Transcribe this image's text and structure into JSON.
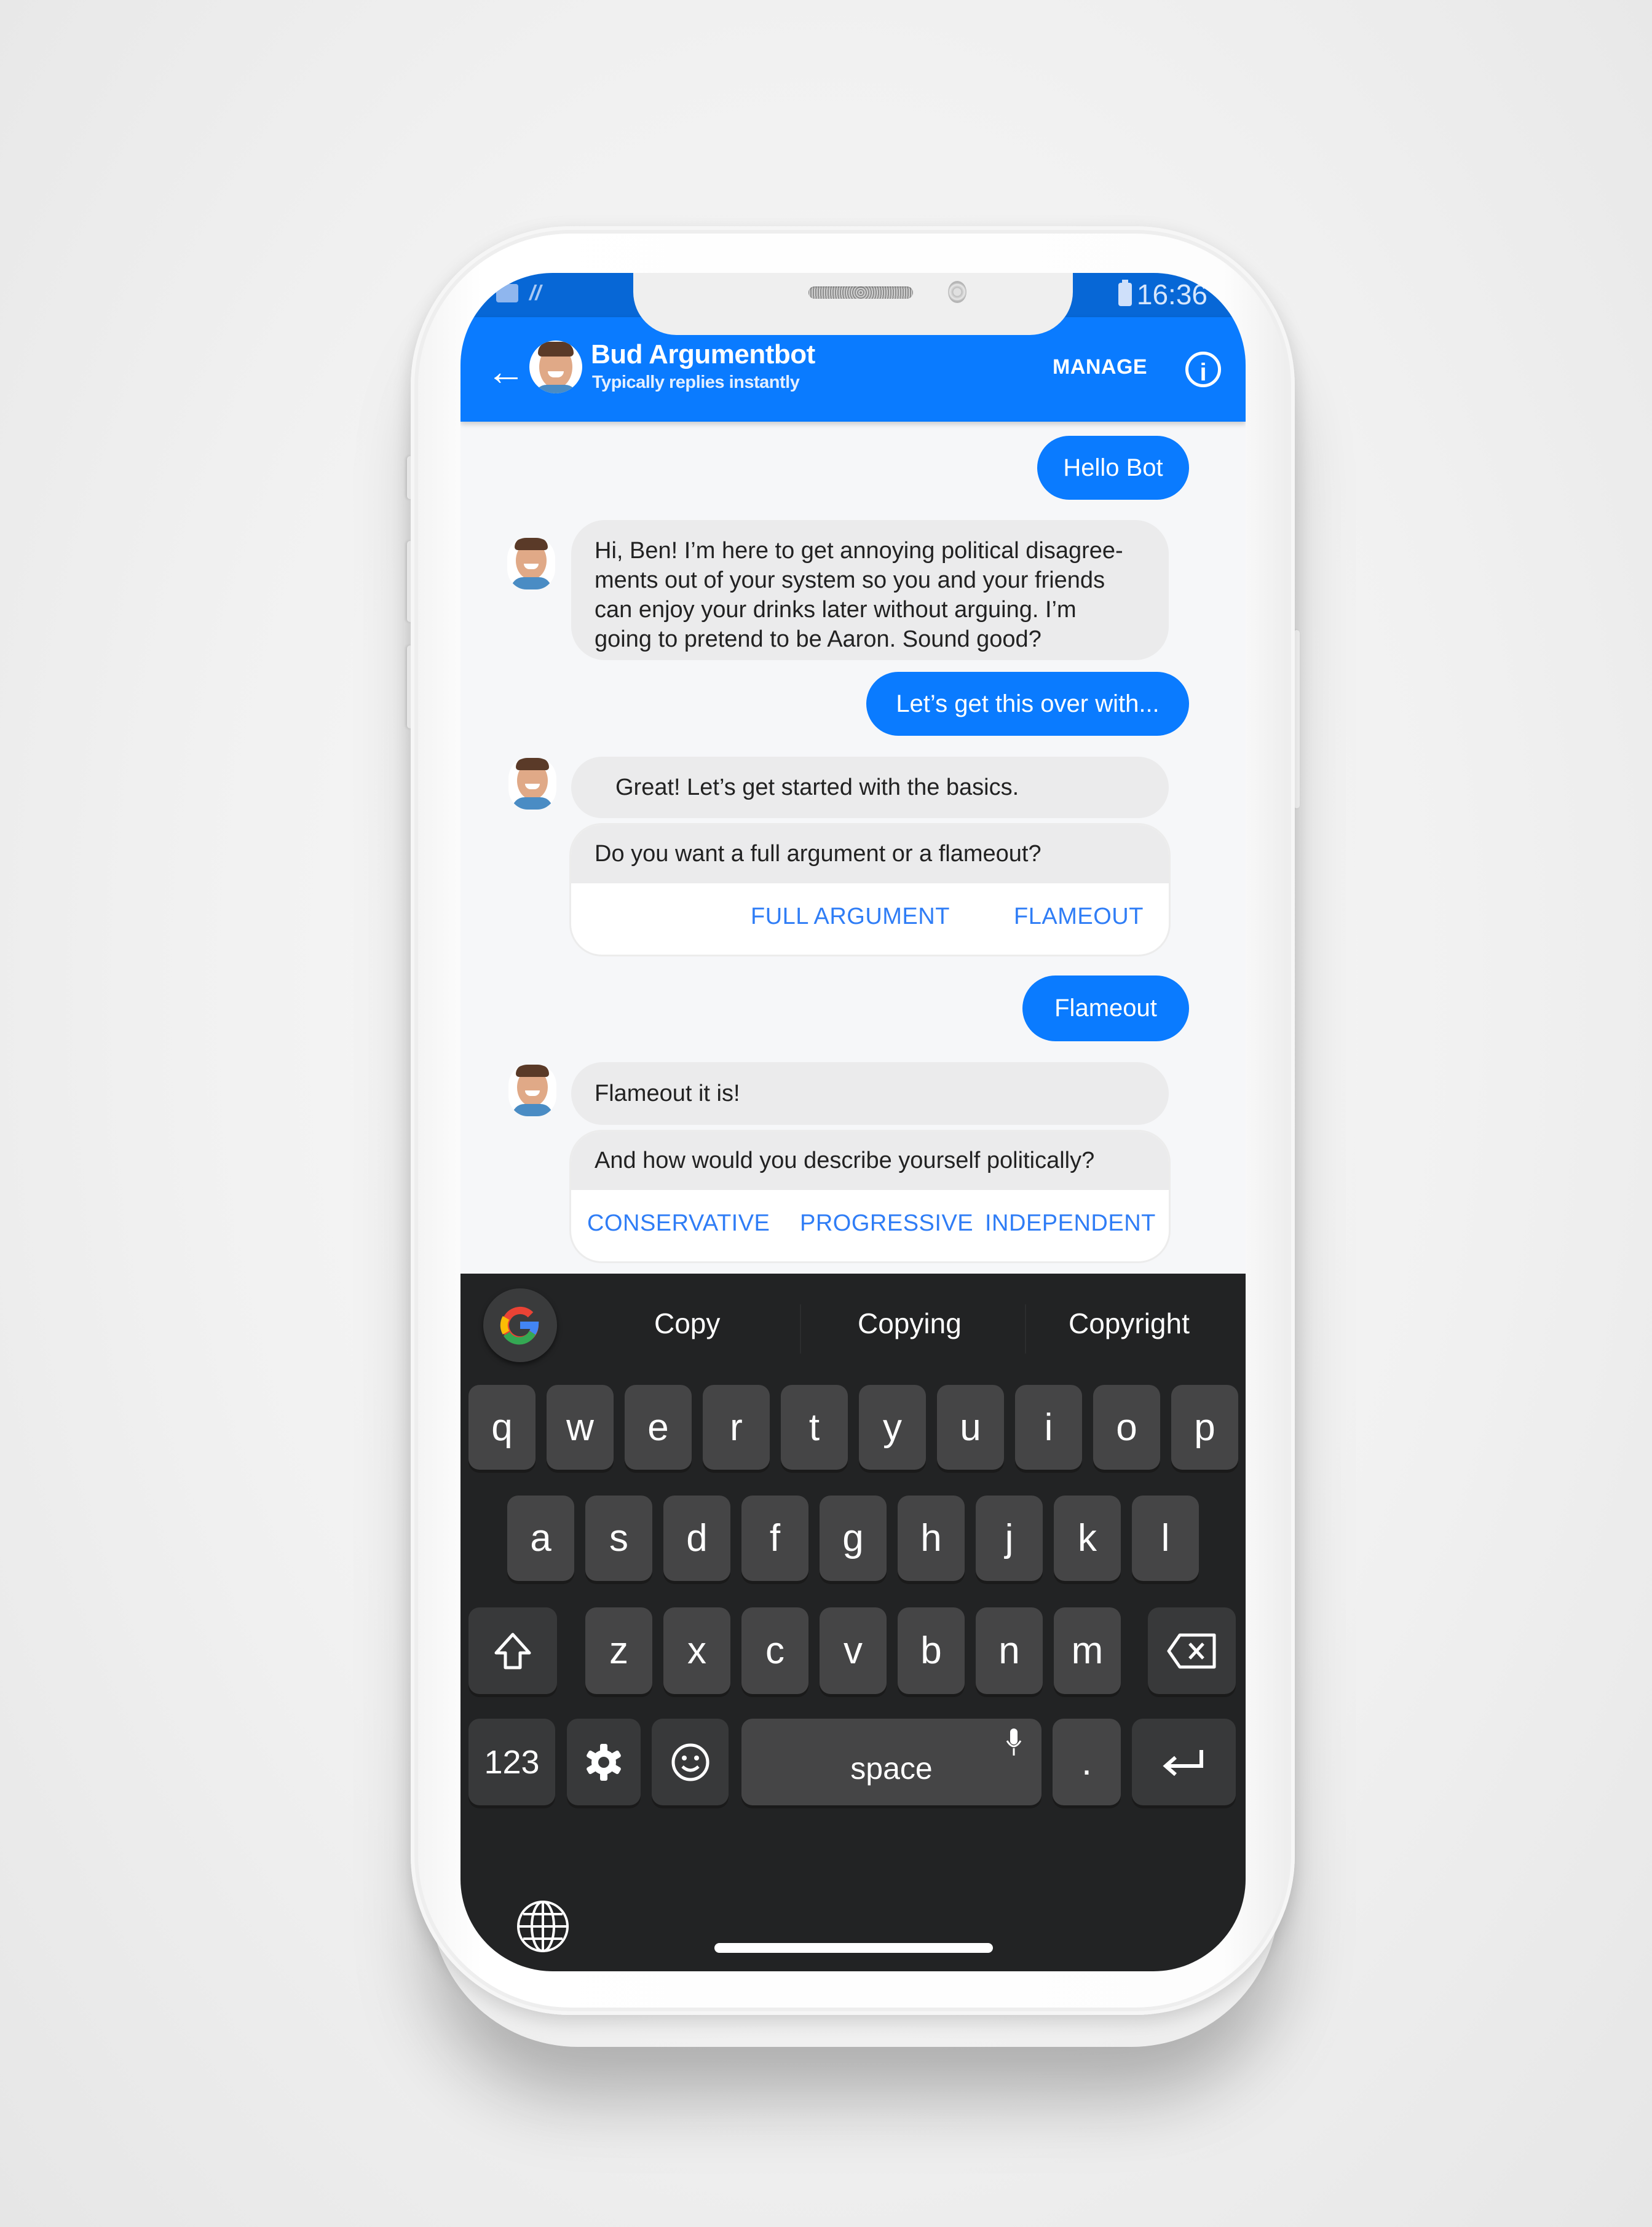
{
  "status_bar": {
    "left_icons": [
      "outlook-icon",
      "signal-scribble-icon"
    ],
    "battery_icon": "battery-icon",
    "time": "16:36"
  },
  "header": {
    "back_icon": "arrow-left-icon",
    "title": "Bud Argumentbot",
    "subtitle": "Typically replies instantly",
    "manage_label": "MANAGE",
    "info_icon": "info-icon",
    "brand_color": "#0a7bff"
  },
  "messages": [
    {
      "from": "user",
      "text": "Hello Bot"
    },
    {
      "from": "bot",
      "text": "Hi, Ben! I’m here to get annoying political disagree-ments out of your system so you and your friends can enjoy your drinks later without arguing. I’m going to pretend to be Aaron. Sound good?",
      "lines": [
        "Hi, Ben! I’m here to get annoying political disagree-",
        "ments out of your system so you and your friends",
        "can enjoy your drinks later without arguing. I’m",
        "going to pretend to be Aaron. Sound good?"
      ]
    },
    {
      "from": "user",
      "text": "Let’s get this over with..."
    },
    {
      "from": "bot",
      "text": "Great! Let’s get started with the basics."
    },
    {
      "from": "bot",
      "text": "Do you want a full argument or a flameout?",
      "quick_replies": [
        "FULL ARGUMENT",
        "FLAMEOUT"
      ]
    },
    {
      "from": "user",
      "text": "Flameout"
    },
    {
      "from": "bot",
      "text": "Flameout it is!"
    },
    {
      "from": "bot",
      "text": "And how would you describe yourself politically?",
      "quick_replies": [
        "CONSERVATIVE",
        "PROGRESSIVE",
        "INDEPENDENT"
      ]
    }
  ],
  "keyboard": {
    "suggestions": [
      "Copy",
      "Copying",
      "Copyright"
    ],
    "row1": [
      "q",
      "w",
      "e",
      "r",
      "t",
      "y",
      "u",
      "i",
      "o",
      "p"
    ],
    "row2": [
      "a",
      "s",
      "d",
      "f",
      "g",
      "h",
      "j",
      "k",
      "l"
    ],
    "row3": [
      "z",
      "x",
      "c",
      "v",
      "b",
      "n",
      "m"
    ],
    "numbers_label": "123",
    "space_label": "space",
    "period_label": ".",
    "quick_reply_color": "#2f7df6"
  }
}
